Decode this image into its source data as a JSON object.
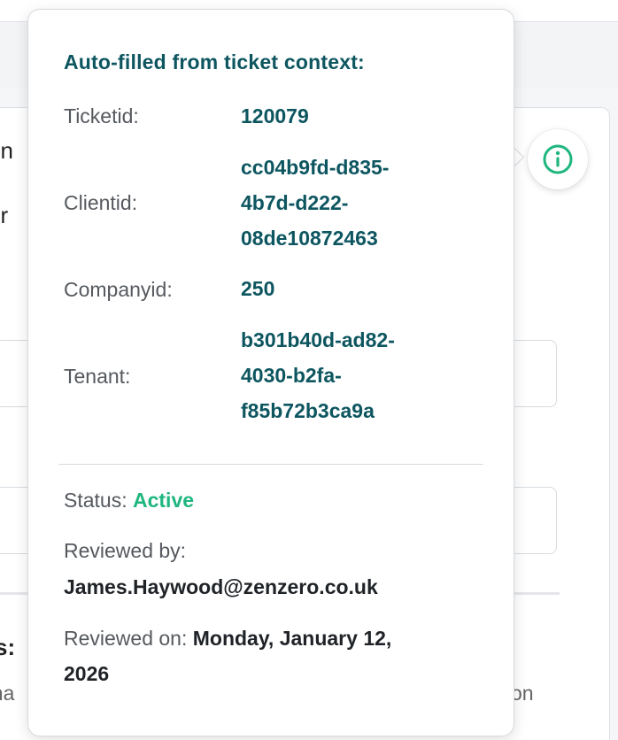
{
  "background": {
    "fragments": [
      "un",
      "er",
      "s:",
      "ona",
      "on"
    ]
  },
  "info_button": {
    "icon": "info-icon",
    "color": "#1fb67f"
  },
  "popover": {
    "heading": "Auto-filled from ticket context:",
    "fields": [
      {
        "label": "Ticketid:",
        "value_lines": [
          "120079"
        ]
      },
      {
        "label": "Clientid:",
        "value_lines": [
          "cc04b9fd-d835-",
          "4b7d-d222-",
          "08de10872463"
        ]
      },
      {
        "label": "Companyid:",
        "value_lines": [
          "250"
        ]
      },
      {
        "label": "Tenant:",
        "value_lines": [
          "b301b40d-ad82-",
          "4030-b2fa-",
          "f85b72b3ca9a"
        ]
      }
    ],
    "status": {
      "label": "Status:",
      "value": "Active",
      "color": "#1fb67f"
    },
    "reviewed_by": {
      "label": "Reviewed by:",
      "value": "James.Haywood@zenzero.co.uk"
    },
    "reviewed_on": {
      "label": "Reviewed on:",
      "date_line1": "Monday, January 12,",
      "date_line2": "2026"
    },
    "accent_color": "#0d5660"
  }
}
